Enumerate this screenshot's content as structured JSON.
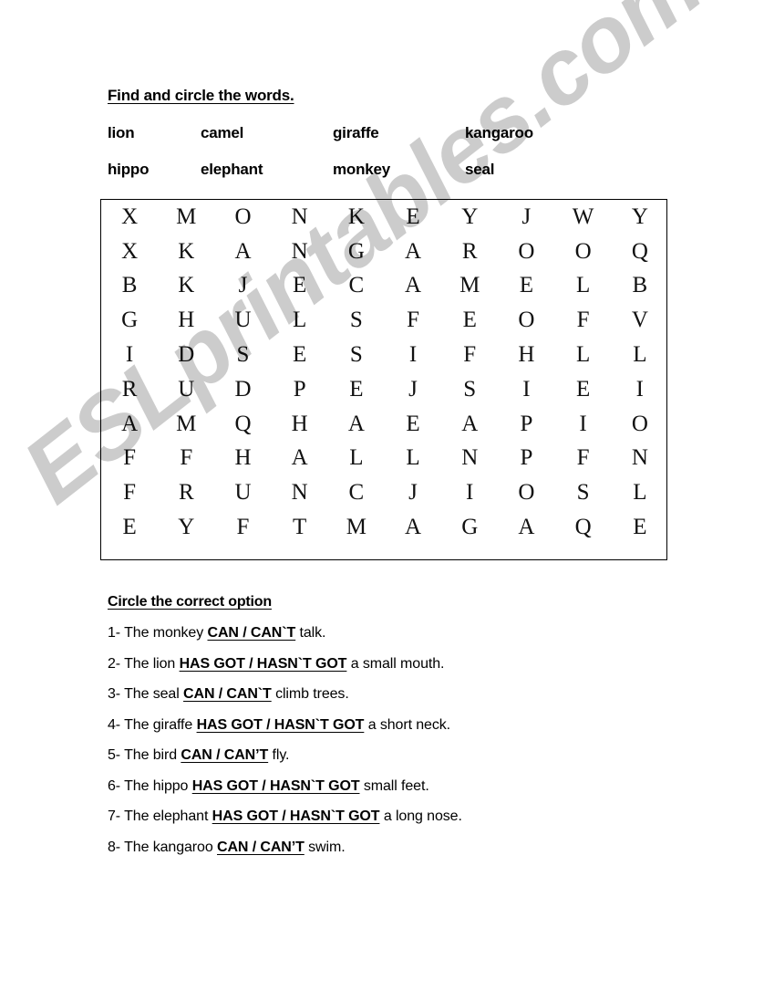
{
  "watermark": {
    "text": "ESLprintables.com"
  },
  "section1": {
    "heading": "Find and circle the words.",
    "words_row1": [
      "lion",
      "camel",
      "giraffe",
      "kangaroo"
    ],
    "words_row2": [
      "hippo",
      "elephant",
      "monkey",
      "seal"
    ]
  },
  "wordsearch": {
    "rows": 10,
    "cols": 10,
    "grid": [
      [
        "X",
        "M",
        "O",
        "N",
        "K",
        "E",
        "Y",
        "J",
        "W",
        "Y"
      ],
      [
        "X",
        "K",
        "A",
        "N",
        "G",
        "A",
        "R",
        "O",
        "O",
        "Q"
      ],
      [
        "B",
        "K",
        "J",
        "E",
        "C",
        "A",
        "M",
        "E",
        "L",
        "B"
      ],
      [
        "G",
        "H",
        "U",
        "L",
        "S",
        "F",
        "E",
        "O",
        "F",
        "V"
      ],
      [
        "I",
        "D",
        "S",
        "E",
        "S",
        "I",
        "F",
        "H",
        "L",
        "L"
      ],
      [
        "R",
        "U",
        "D",
        "P",
        "E",
        "J",
        "S",
        "I",
        "E",
        "I"
      ],
      [
        "A",
        "M",
        "Q",
        "H",
        "A",
        "E",
        "A",
        "P",
        "I",
        "O"
      ],
      [
        "F",
        "F",
        "H",
        "A",
        "L",
        "L",
        "N",
        "P",
        "F",
        "N"
      ],
      [
        "F",
        "R",
        "U",
        "N",
        "C",
        "J",
        "I",
        "O",
        "S",
        "L"
      ],
      [
        "E",
        "Y",
        "F",
        "T",
        "M",
        "A",
        "G",
        "A",
        "Q",
        "E"
      ]
    ]
  },
  "section2": {
    "heading": "Circle the correct option",
    "questions": [
      {
        "num": "1-",
        "pre": "The monkey",
        "option": "CAN / CAN`T",
        "post": "talk."
      },
      {
        "num": "2-",
        "pre": "The lion",
        "option": "HAS GOT / HASN`T GOT",
        "post": "a small mouth."
      },
      {
        "num": "3-",
        "pre": "The seal",
        "option": "CAN / CAN`T",
        "post": "climb trees."
      },
      {
        "num": "4-",
        "pre": "The giraffe",
        "option": "HAS GOT / HASN`T GOT",
        "post": "a short neck."
      },
      {
        "num": "5-",
        "pre": "The bird",
        "option": "CAN / CAN’T",
        "post": "fly."
      },
      {
        "num": "6-",
        "pre": "The hippo",
        "option": "HAS GOT / HASN`T GOT",
        "post": "small feet."
      },
      {
        "num": "7-",
        "pre": "The elephant",
        "option": "HAS GOT / HASN`T GOT",
        "post": "a long nose."
      },
      {
        "num": "8-",
        "pre": "The kangaroo",
        "option": "CAN / CAN’T",
        "post": "swim."
      }
    ]
  }
}
